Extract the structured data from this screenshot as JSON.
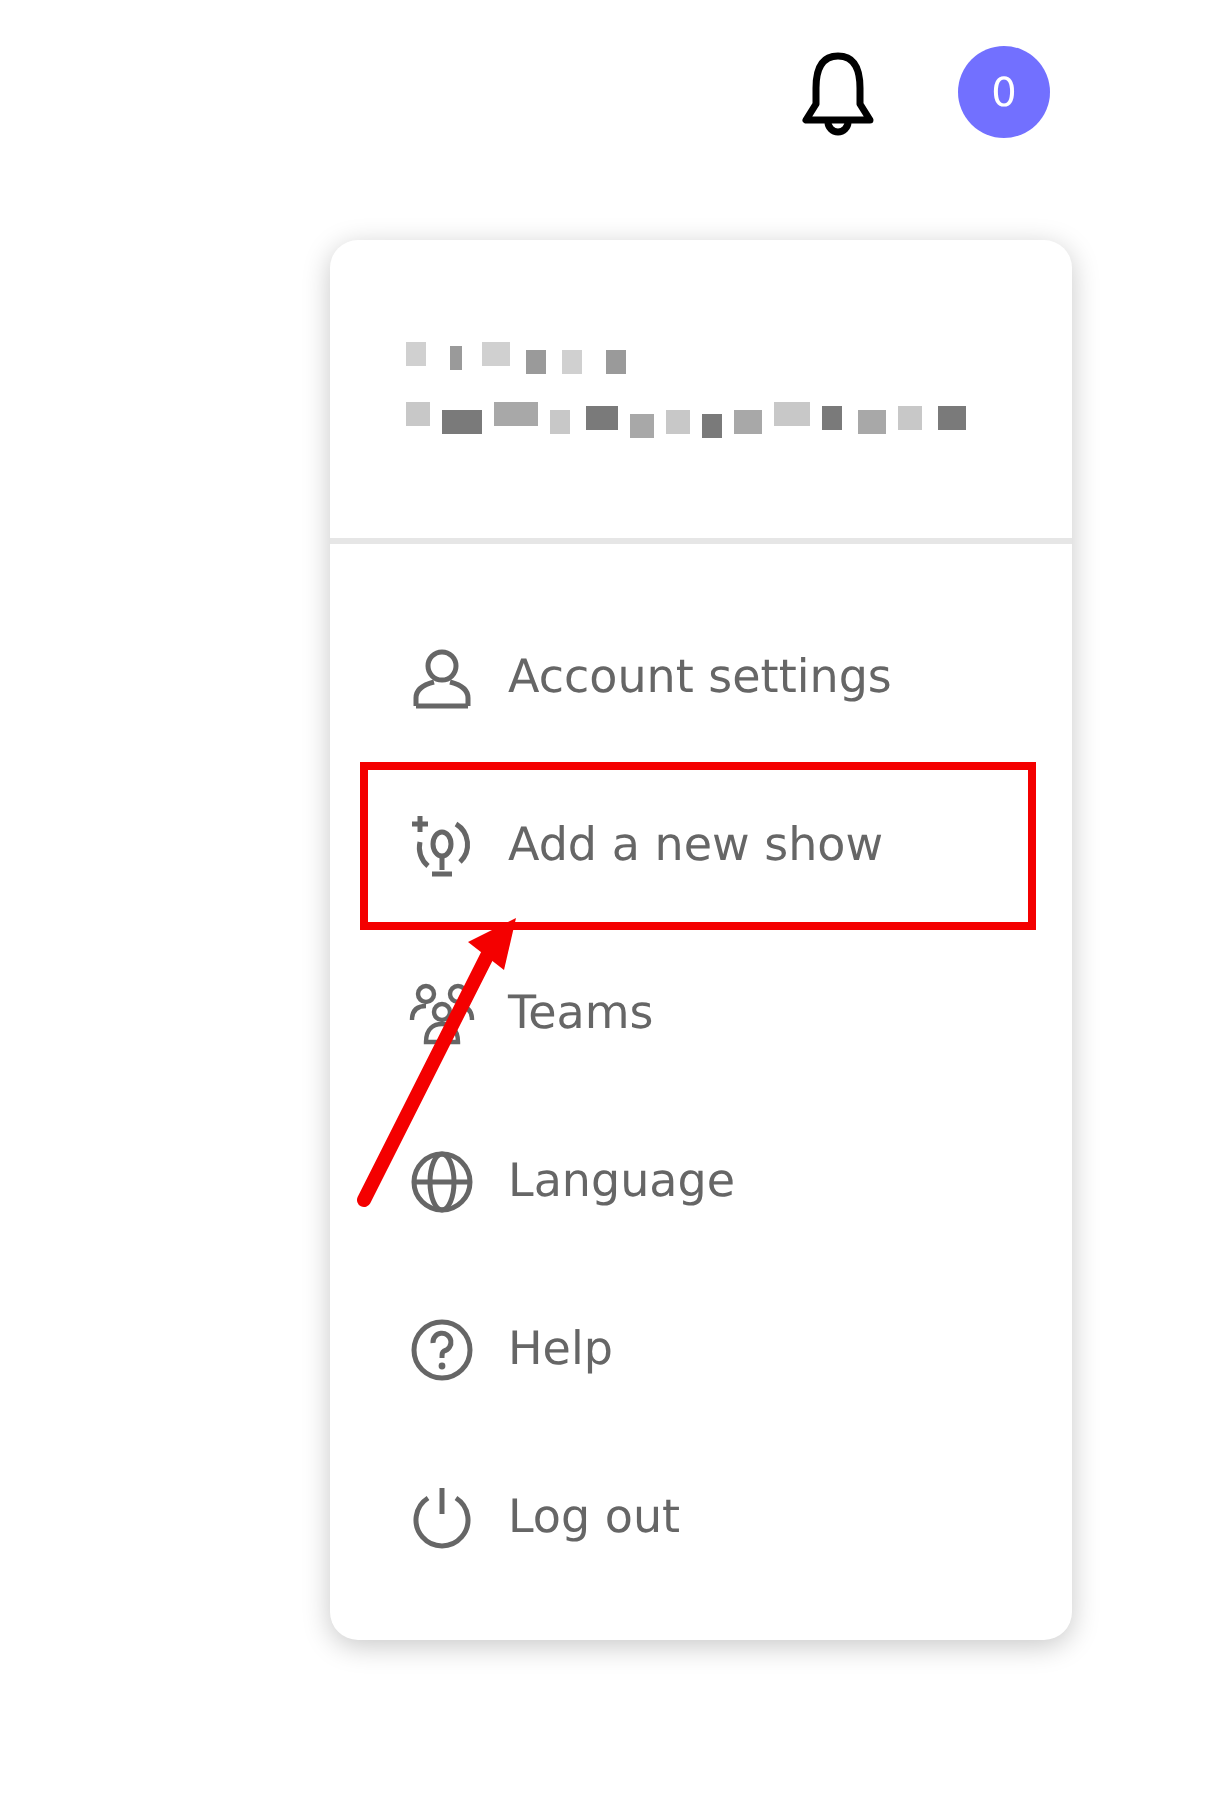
{
  "header": {
    "notification_count": "0"
  },
  "menu": {
    "items": [
      {
        "kind": "account",
        "label": "Account settings",
        "highlighted": false
      },
      {
        "kind": "show",
        "label": "Add a new show",
        "highlighted": true
      },
      {
        "kind": "teams",
        "label": "Teams",
        "highlighted": false
      },
      {
        "kind": "language",
        "label": "Language",
        "highlighted": false
      },
      {
        "kind": "help",
        "label": "Help",
        "highlighted": false
      },
      {
        "kind": "logout",
        "label": "Log out",
        "highlighted": false
      }
    ]
  }
}
